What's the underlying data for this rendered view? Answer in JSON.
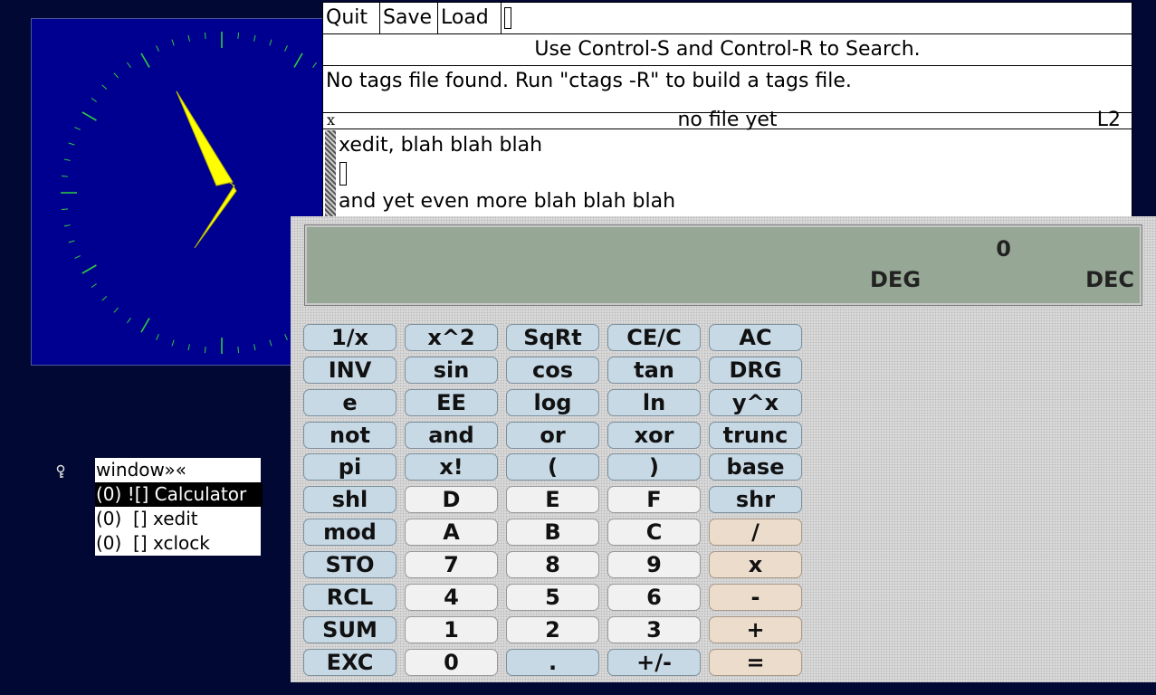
{
  "xedit": {
    "commands": [
      "Quit",
      "Save",
      "Load"
    ],
    "search_hint": "Use Control-S and Control-R to Search.",
    "message": "No tags file found. Run \"ctags -R\" to build a tags file.",
    "status": {
      "modified_flag": "x",
      "filename": "no file yet",
      "line": "L2"
    },
    "text_lines": [
      "xedit, blah blah blah",
      "",
      "and yet even more blah blah blah"
    ]
  },
  "xcalc": {
    "display": {
      "value": "0",
      "angle_mode": "DEG",
      "base_mode": "DEC"
    },
    "keys": [
      [
        "1/x",
        "x^2",
        "SqRt",
        "CE/C",
        "AC"
      ],
      [
        "INV",
        "sin",
        "cos",
        "tan",
        "DRG"
      ],
      [
        "e",
        "EE",
        "log",
        "ln",
        "y^x"
      ],
      [
        "not",
        "and",
        "or",
        "xor",
        "trunc"
      ],
      [
        "pi",
        "x!",
        "(",
        ")",
        "base"
      ],
      [
        "shl",
        "D",
        "E",
        "F",
        "shr"
      ],
      [
        "mod",
        "A",
        "B",
        "C",
        "/"
      ],
      [
        "STO",
        "7",
        "8",
        "9",
        "x"
      ],
      [
        "RCL",
        "4",
        "5",
        "6",
        "-"
      ],
      [
        "SUM",
        "1",
        "2",
        "3",
        "+"
      ],
      [
        "EXC",
        "0",
        ".",
        "+/-",
        "="
      ]
    ],
    "key_colors": {
      "function": "#c8d9e6",
      "digit": "#f1f1f1",
      "operator": "#ecdccb"
    }
  },
  "window_list": {
    "title": "window»«",
    "items": [
      {
        "label": "(0) ![] Calculator",
        "selected": true
      },
      {
        "label": "(0)  [] xedit",
        "selected": false
      },
      {
        "label": "(0)  [] xclock",
        "selected": false
      }
    ],
    "icon": "key-icon"
  },
  "xclock": {
    "hand_color": "#ffff00",
    "tick_color": "#2ecc40",
    "face_color": "#000090"
  }
}
